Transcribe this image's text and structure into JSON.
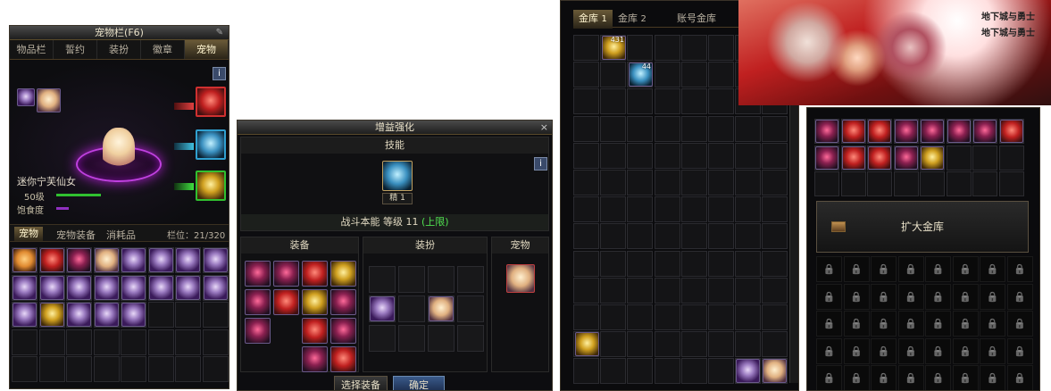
{
  "pet_window": {
    "title": "宠物栏(F6)",
    "tabs": [
      "物品栏",
      "誓约",
      "装扮",
      "徽章",
      "宠物"
    ],
    "pet_name": "迷你宁芙仙女",
    "level_label": "50级",
    "fullness_label": "饱食度",
    "sub_tabs": [
      "宠物",
      "宠物装备",
      "消耗品"
    ],
    "slot_count": "栏位：21/320",
    "info_icon": "i"
  },
  "enhance_window": {
    "title": "增益强化",
    "skill_header": "技能",
    "skill_badge": "精",
    "skill_level": "1",
    "skill_text": "战斗本能 等级 11",
    "skill_limit": "(上限)",
    "sections": [
      "装备",
      "装扮",
      "宠物"
    ],
    "select_button": "选择装备",
    "confirm_button": "确定",
    "info_icon": "i",
    "close_icon": "×"
  },
  "vault_window": {
    "tabs": [
      "金库",
      "1",
      "金库",
      "2",
      "账号金库"
    ],
    "item_counts": [
      "431",
      "44"
    ]
  },
  "expand_window": {
    "expand_button": "扩大金库"
  },
  "banner": {
    "logo_text": "地下城与勇士"
  }
}
